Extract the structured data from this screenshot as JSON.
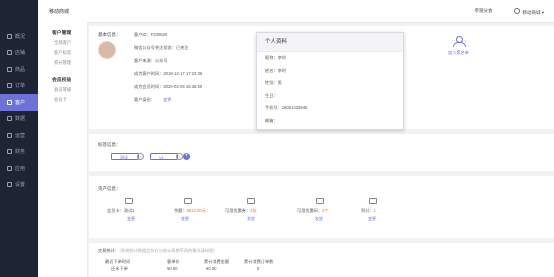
{
  "app": {
    "title": "移动商城"
  },
  "topbar": {
    "shop_switch": "移动商城",
    "shop_name": "参观分会"
  },
  "nav": {
    "items": [
      {
        "label": "概况"
      },
      {
        "label": "店铺"
      },
      {
        "label": "商品"
      },
      {
        "label": "订单"
      },
      {
        "label": "客户"
      },
      {
        "label": "数据"
      },
      {
        "label": "运营"
      },
      {
        "label": "财务"
      },
      {
        "label": "应用"
      },
      {
        "label": "设置"
      }
    ],
    "active_index": 4
  },
  "subnav": {
    "group1_title": "客户管理",
    "group1_items": [
      "全部客户",
      "客户标签",
      "积分管理"
    ],
    "group2_title": "会员权益",
    "group2_items": [
      "会员等级",
      "会员卡"
    ]
  },
  "basic": {
    "section_label": "基本信息：",
    "customer_id": "客户ID：F330520",
    "wechat_status": "微信公众号关注状态：已关注",
    "source": "客户来源：公众号",
    "become_customer": "成为客户时间：2019-12-17 17:22:35",
    "become_member": "成为会员时间：2020-02-04 16:36:50",
    "identity_label": "客户身份：",
    "identity_link": "变更",
    "add_blacklist": "加入黑名单"
  },
  "popup": {
    "title": "个人资料",
    "rows": [
      "昵称：李时",
      "姓名：李时",
      "性别：男",
      "生日：",
      "手机号：18001433945",
      "邮箱："
    ]
  },
  "tags": {
    "section_label": "标签信息：",
    "items": [
      "测试",
      "V1"
    ]
  },
  "assets": {
    "section_label": "资产信息：",
    "items": [
      {
        "label": "会员卡：",
        "value": "测试1",
        "link": "变更"
      },
      {
        "label": "余额：",
        "value": "5812.00元",
        "link": "变更"
      },
      {
        "label": "可用优惠券：",
        "value": "2张",
        "link": "发放"
      },
      {
        "label": "可用优惠码：",
        "value": "0个",
        "link": "发放"
      },
      {
        "label": "积分：",
        "value": "1",
        "link": "变更"
      }
    ]
  },
  "stats": {
    "section_label": "交易统计：",
    "note": "（系统统计数据会存在与统计周期不同的情况请知悉）",
    "columns": [
      {
        "header": "最近下单时间",
        "value": "还未下单"
      },
      {
        "header": "客单价",
        "value": "¥0.00"
      },
      {
        "header": "累计消费金额",
        "value": "¥0.00"
      },
      {
        "header": "累计消费订单数",
        "value": "0"
      }
    ]
  },
  "colors": {
    "accent": "#6e72d8",
    "nav_bg": "#1f2434",
    "value_orange": "#e07c3c"
  }
}
